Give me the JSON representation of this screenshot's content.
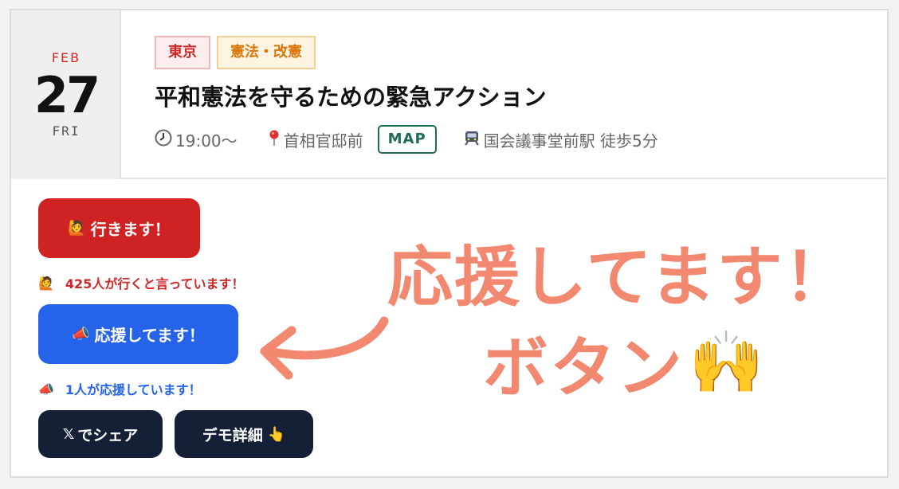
{
  "event": {
    "date": {
      "month": "FEB",
      "day": "27",
      "weekday": "FRI"
    },
    "tags": [
      "東京",
      "憲法・改憲"
    ],
    "title": "平和憲法を守るための緊急アクション",
    "time": "19:00〜",
    "place": "首相官邸前",
    "map_label": "MAP",
    "access": "国会議事堂前駅 徒歩5分"
  },
  "actions": {
    "go_emoji": "🙋",
    "go_label": "行きます！",
    "go_count_emoji": "🙋",
    "go_count_text": "425人が行くと言っています！",
    "cheer_emoji": "📣",
    "cheer_label": "応援してます！",
    "cheer_count_emoji": "📣",
    "cheer_count_text": "1人が応援しています！",
    "share_logo": "𝕏",
    "share_label": "でシェア",
    "detail_label": "デモ詳細",
    "detail_emoji": "👆"
  },
  "annotation": {
    "line1": "応援してます！",
    "line2": "ボタン",
    "hands_emoji": "🙌"
  },
  "colors": {
    "go_button": "#cf2222",
    "cheer_button": "#2563eb",
    "dark_button": "#142035",
    "annotation": "#f28870",
    "map_border": "#1f6b5a"
  },
  "icons": [
    "clock-icon",
    "pin-icon",
    "train-icon"
  ]
}
